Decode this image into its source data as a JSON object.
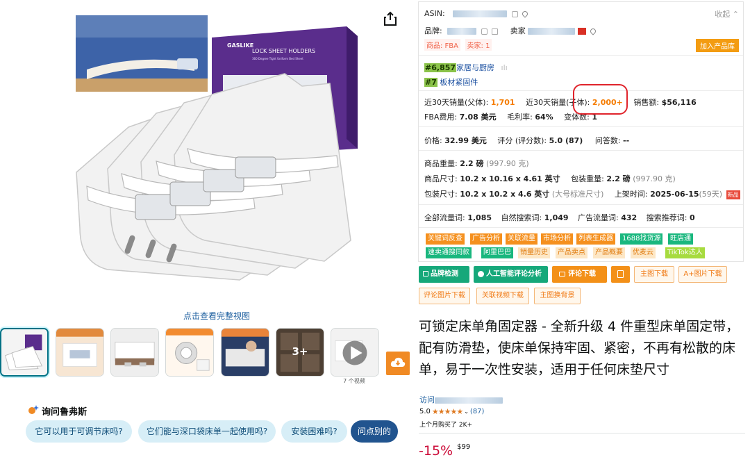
{
  "gallery": {
    "full_view_label": "点击查看完整视图",
    "more_thumbs_label": "3+",
    "video_caption": "7 个视频"
  },
  "box_art": {
    "brand": "GASLIKE",
    "title": "LOCK SHEET HOLDERS",
    "subtitle": "360 Degree Tight Uniform Bed Sheet"
  },
  "rufus": {
    "title": "询问鲁弗斯",
    "questions": [
      "它可以用于可调节床吗?",
      "它们能与深口袋床单一起使用吗?",
      "安装困难吗?",
      "问点别的"
    ]
  },
  "panel": {
    "asin_label": "ASIN:",
    "collect_label": "收起",
    "brand_label": "品牌:",
    "seller_label": "卖家",
    "fba_tag": "商品: FBA",
    "seller_tag": "卖家: 1",
    "add_button": "加入产品库",
    "rank1": "#6,857",
    "rank1_cat": "家居与厨房",
    "rank2": "#7",
    "rank2_cat": "板材紧固件",
    "sales_parent_label": "近30天销量(父体):",
    "sales_parent": "1,701",
    "sales_child_label": "近30天销量(子体):",
    "sales_child": "2,000+",
    "revenue_label": "销售额:",
    "revenue": "$56,116",
    "fba_fee_label": "FBA费用:",
    "fba_fee": "7.08 美元",
    "margin_label": "毛利率:",
    "margin": "64%",
    "variants_label": "变体数:",
    "variants": "1",
    "price_label": "价格:",
    "price": "32.99 美元",
    "rating_label": "评分 (评分数):",
    "rating": "5.0 (87)",
    "qa_label": "问答数:",
    "qa": "--",
    "weight_label": "商品重量:",
    "weight": "2.2 磅",
    "weight_g": "(997.90 克)",
    "dims_label": "商品尺寸:",
    "dims": "10.2 x 10.16 x 4.61 英寸",
    "pkg_weight_label": "包装重量:",
    "pkg_weight": "2.2 磅",
    "pkg_weight_g": "(997.90 克)",
    "pkg_dims_label": "包装尺寸:",
    "pkg_dims": "10.2 x 10.2 x 4.6 英寸",
    "pkg_size_class": "(大号标准尺寸)",
    "listed_label": "上架时间:",
    "listed": "2025-06-15",
    "listed_days": "(59天)",
    "new_badge": "新品",
    "traffic_label": "全部流量词:",
    "traffic": "1,085",
    "organic_label": "自然搜索词:",
    "organic": "1,049",
    "ad_label": "广告流量词:",
    "ad": "432",
    "rec_label": "搜索推荐词:",
    "rec": "0",
    "tags_row1": [
      "关键词反查",
      "广告分析",
      "关联流量",
      "市场分析",
      "列表生成器",
      "1688找货源",
      "旺店通"
    ],
    "tags_row2": [
      "速卖通搜同款",
      "阿里巴巴",
      "销量历史",
      "产品卖点",
      "产品概要",
      "优麦云",
      "TikTok达人"
    ]
  },
  "actions": {
    "brand_check": "品牌检测",
    "ai_review": "人工智能评论分析",
    "review_download": "评论下载",
    "main_img_download": "主图下载",
    "aplus_download": "A+图片下载",
    "review_img_download": "评论图片下载",
    "related_video_download": "关联视频下载",
    "main_bg_replace": "主图换背景"
  },
  "product": {
    "title": "可锁定床单角固定器 - 全新升级 4 件重型床单固定带，配有防滑垫，使床单保持牢固、紧密，不再有松散的床单，易于一次性安装，适用于任何床垫尺寸",
    "store_prefix": "访问",
    "rating_value": "5.0",
    "stars": "★★★★★",
    "rating_count": "(87)",
    "bought": "上个月购买了 2K+",
    "discount": "-15%",
    "price_sup": "$99"
  }
}
